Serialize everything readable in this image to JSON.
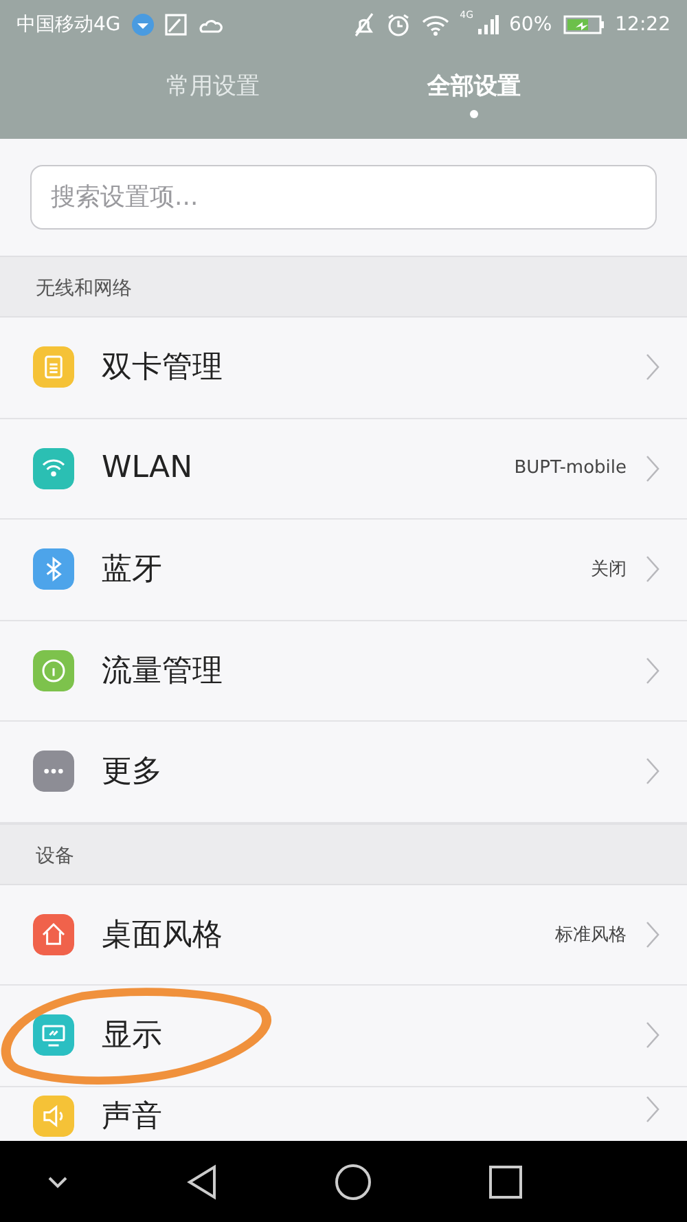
{
  "status_bar": {
    "carrier": "中国移动4G",
    "network": "4G",
    "battery": "60%",
    "time": "12:22"
  },
  "tabs": [
    {
      "label": "常用设置",
      "selected": false
    },
    {
      "label": "全部设置",
      "selected": true
    }
  ],
  "search": {
    "placeholder": "搜索设置项..."
  },
  "sections": [
    {
      "title": "无线和网络",
      "items": [
        {
          "label": "双卡管理",
          "value": null,
          "color": "#f5c237",
          "highlighted": false
        },
        {
          "label": "WLAN",
          "value": "BUPT-mobile",
          "color": "#2bbfb3",
          "highlighted": false
        },
        {
          "label": "蓝牙",
          "value": "关闭",
          "color": "#4da4ea",
          "highlighted": false
        },
        {
          "label": "流量管理",
          "value": null,
          "color": "#7dc24c",
          "highlighted": false
        },
        {
          "label": "更多",
          "value": null,
          "color": "#8d8d95",
          "highlighted": false
        }
      ]
    },
    {
      "title": "设备",
      "items": [
        {
          "label": "桌面风格",
          "value": "标准风格",
          "color": "#f0624b",
          "highlighted": false
        },
        {
          "label": "显示",
          "value": null,
          "color": "#2bbfc2",
          "highlighted": true
        },
        {
          "label": "声音",
          "value": null,
          "color": "#f5c237",
          "highlighted": false
        }
      ]
    }
  ]
}
